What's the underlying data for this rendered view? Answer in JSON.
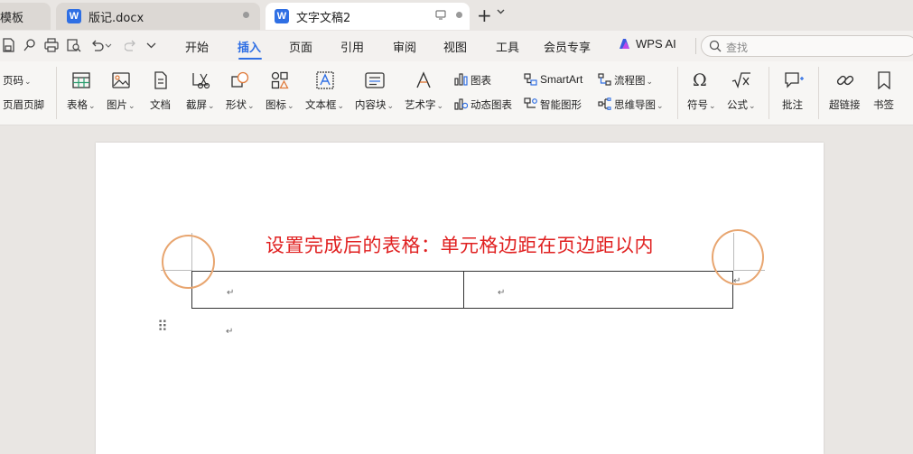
{
  "tabs": [
    {
      "label": "模板",
      "active": false
    },
    {
      "label": "版记.docx",
      "active": false,
      "icon": "wps-writer-icon"
    },
    {
      "label": "文字文稿2",
      "active": true,
      "icon": "wps-writer-icon"
    }
  ],
  "menu": {
    "items": [
      "开始",
      "插入",
      "页面",
      "引用",
      "审阅",
      "视图",
      "工具",
      "会员专享"
    ],
    "active": "插入",
    "wps_ai": "WPS AI",
    "search_placeholder": "查找"
  },
  "ribbon": {
    "page_number": "页码",
    "header_footer": "页眉页脚",
    "table": "表格",
    "picture": "图片",
    "document": "文档",
    "screenshot": "截屏",
    "shape": "形状",
    "icon": "图标",
    "textbox": "文本框",
    "content_block": "内容块",
    "wordart": "艺术字",
    "chart": "图表",
    "dynamic_chart": "动态图表",
    "smartart": "SmartArt",
    "smart_shape": "智能图形",
    "flowchart": "流程图",
    "mindmap": "思维导图",
    "symbol": "符号",
    "formula": "公式",
    "comment": "批注",
    "hyperlink": "超链接",
    "bookmark": "书签"
  },
  "document": {
    "caption": "设置完成后的表格：单元格边距在页边距以内",
    "paragraph_mark": "↵"
  },
  "colors": {
    "accent": "#2f6fe4",
    "caption": "#e02020",
    "annotation_circle": "#e8a56f"
  }
}
